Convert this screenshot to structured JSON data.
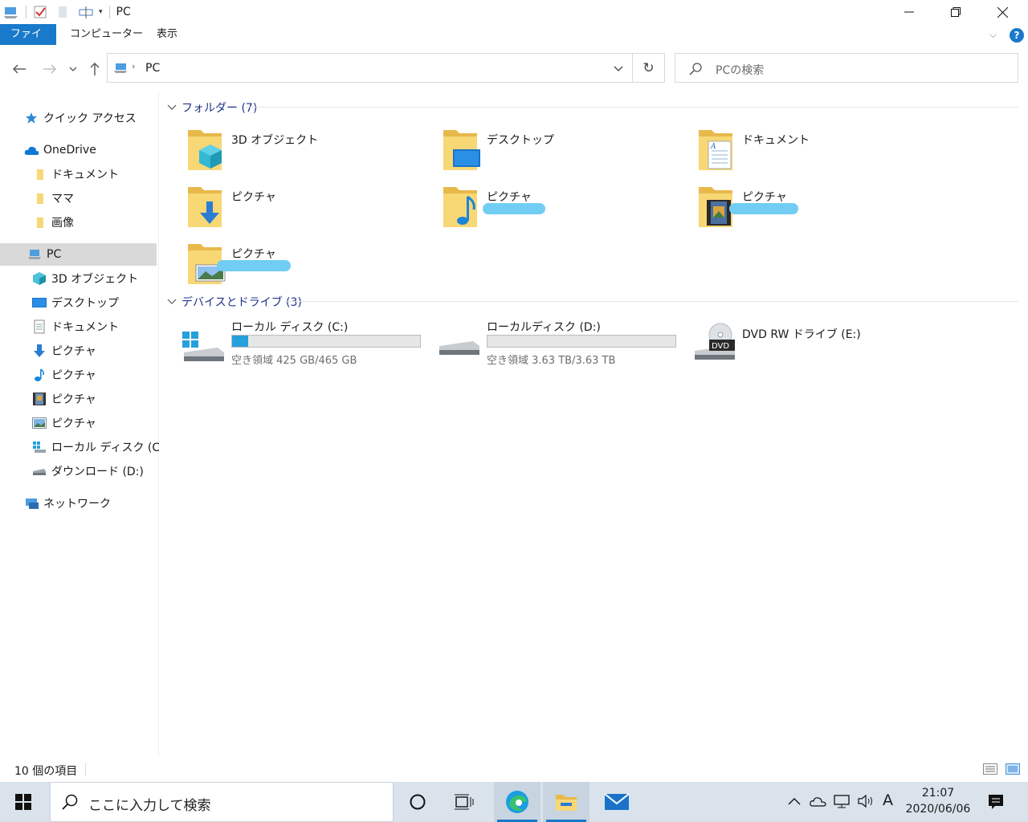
{
  "window": {
    "title": "PC",
    "tabs": [
      {
        "label": "ファイル",
        "active": true
      },
      {
        "label": "コンピューター",
        "active": false
      },
      {
        "label": "表示",
        "active": false
      }
    ]
  },
  "address": {
    "path_label": "PC",
    "search_placeholder": "PCの検索"
  },
  "nav": {
    "quick_access": "クイック アクセス",
    "onedrive": "OneDrive",
    "onedrive_children": [
      "ドキュメント",
      "ママ",
      "画像"
    ],
    "pc": "PC",
    "pc_children": [
      "3D オブジェクト",
      "デスクトップ",
      "ドキュメント",
      "ピクチャ",
      "ピクチャ",
      "ピクチャ",
      "ピクチャ",
      "ローカル ディスク (C:)",
      "ダウンロード (D:)"
    ],
    "network": "ネットワーク"
  },
  "folders": {
    "header": "フォルダー (7)",
    "items": [
      "3D オブジェクト",
      "デスクトップ",
      "ドキュメント",
      "ピクチャ",
      "ピクチャ",
      "ピクチャ",
      "ピクチャ"
    ]
  },
  "drives": {
    "header": "デバイスとドライブ (3)",
    "items": [
      {
        "name": "ローカル ディスク (C:)",
        "free": "空き領域 425 GB/465 GB",
        "used_fraction": 0.086
      },
      {
        "name": "ローカルディスク (D:)",
        "free": "空き領域 3.63 TB/3.63 TB",
        "used_fraction": 0.0
      },
      {
        "name": "DVD RW ドライブ (E:)"
      }
    ]
  },
  "status": {
    "item_count": "10 個の項目"
  },
  "taskbar": {
    "search_placeholder": "ここに入力して検索",
    "time": "21:07",
    "date": "2020/06/06",
    "ime": "A"
  },
  "colors": {
    "accent": "#1979ca",
    "group_header": "#1e3287",
    "progress": "#26a0da",
    "taskbar": "#dae3ec",
    "folder": "#f8d775"
  }
}
